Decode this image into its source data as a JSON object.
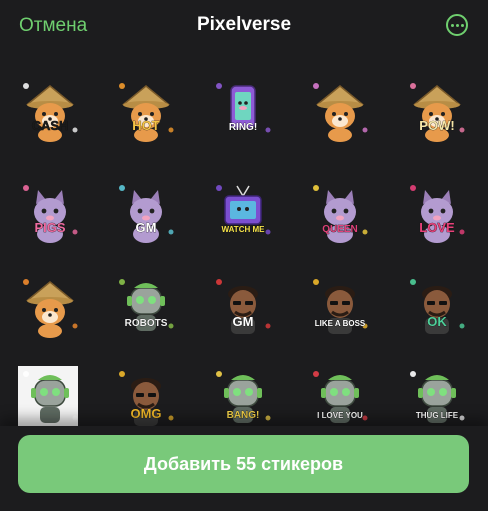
{
  "header": {
    "cancel_label": "Отмена",
    "title": "Pixelverse"
  },
  "stickers": [
    {
      "name": "sticker-cash-dog",
      "kind": "dog",
      "text": "CASH",
      "accent": "#f4f4f4",
      "text_color": "#1a1a1a"
    },
    {
      "name": "sticker-hot-dog",
      "kind": "dog",
      "text": "HOT",
      "accent": "#f39a2b",
      "text_color": "#f6c445"
    },
    {
      "name": "sticker-ring-phone",
      "kind": "phone",
      "text": "RING!",
      "accent": "#8e5bd6",
      "text_color": "#ffffff"
    },
    {
      "name": "sticker-candy-dog",
      "kind": "dog",
      "text": "",
      "accent": "#d97bd0",
      "text_color": "#ffffff"
    },
    {
      "name": "sticker-pow-dog",
      "kind": "dog",
      "text": "POW!",
      "accent": "#f07aa8",
      "text_color": "#f6e6a8"
    },
    {
      "name": "sticker-pigs-cat",
      "kind": "cat",
      "text": "PIGS",
      "accent": "#ef6aa0",
      "text_color": "#ef6aa0"
    },
    {
      "name": "sticker-gm-cat",
      "kind": "cat",
      "text": "GM",
      "accent": "#5cc9d8",
      "text_color": "#ffffff"
    },
    {
      "name": "sticker-watch-me-tv",
      "kind": "tv",
      "text": "WATCH ME",
      "accent": "#7b4fd0",
      "text_color": "#f6e34a"
    },
    {
      "name": "sticker-queen-cat",
      "kind": "cat",
      "text": "QUEEN",
      "accent": "#f5d23d",
      "text_color": "#e0417a"
    },
    {
      "name": "sticker-love-cat",
      "kind": "cat",
      "text": "LOVE",
      "accent": "#e8407a",
      "text_color": "#e8407a"
    },
    {
      "name": "sticker-bone-dog",
      "kind": "dog",
      "text": "",
      "accent": "#f28b2c",
      "text_color": "#ffffff"
    },
    {
      "name": "sticker-robots-robot",
      "kind": "robot",
      "text": "ROBOTS",
      "accent": "#8bc34a",
      "text_color": "#f2f2f2"
    },
    {
      "name": "sticker-gm-man",
      "kind": "man",
      "text": "GM",
      "accent": "#e03b3b",
      "text_color": "#ffffff"
    },
    {
      "name": "sticker-boss-man",
      "kind": "man",
      "text": "LIKE A BOSS",
      "accent": "#f0b82a",
      "text_color": "#ffffff"
    },
    {
      "name": "sticker-ok-man",
      "kind": "man",
      "text": "OK",
      "accent": "#4fd09a",
      "text_color": "#4fd09a"
    },
    {
      "name": "sticker-robot-card",
      "kind": "robot",
      "text": "",
      "accent": "#ffffff",
      "text_color": "#ffffff"
    },
    {
      "name": "sticker-omg-man",
      "kind": "man",
      "text": "OMG",
      "accent": "#f0b82a",
      "text_color": "#f0b82a"
    },
    {
      "name": "sticker-bang-robot",
      "kind": "robot",
      "text": "BANG!",
      "accent": "#f6d44a",
      "text_color": "#f6d44a"
    },
    {
      "name": "sticker-love-you-robot",
      "kind": "robot",
      "text": "I LOVE YOU",
      "accent": "#e8404a",
      "text_color": "#ffffff"
    },
    {
      "name": "sticker-thug-life-robot",
      "kind": "robot",
      "text": "THUG LIFE",
      "accent": "#ffffff",
      "text_color": "#ffffff"
    }
  ],
  "footer": {
    "add_button_label": "Добавить 55 стикеров"
  },
  "colors": {
    "background": "#1c1c1e",
    "accent_green": "#6fcf6f",
    "button_green": "#79c97a"
  }
}
